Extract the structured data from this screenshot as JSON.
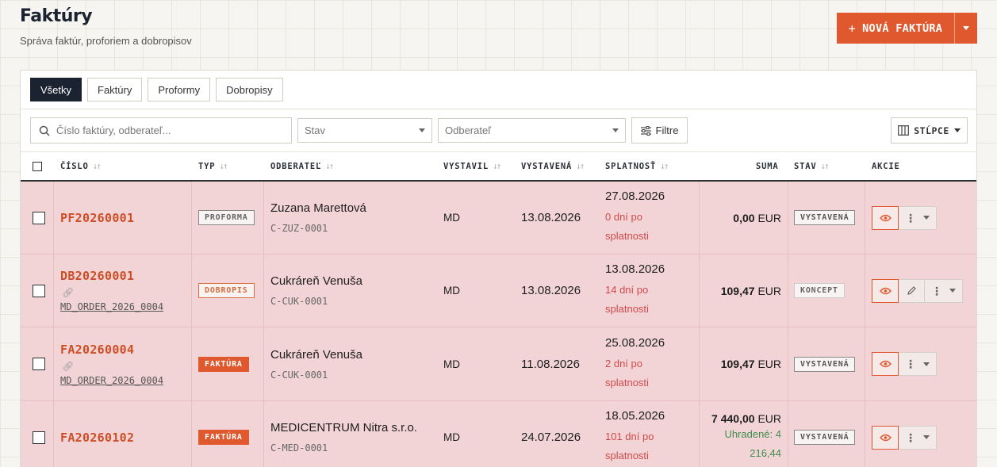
{
  "header": {
    "title": "Faktúry",
    "subtitle": "Správa faktúr, proforiem a dobropisov",
    "new_button": "NOVÁ FAKTÚRA"
  },
  "tabs": [
    {
      "label": "Všetky",
      "active": true
    },
    {
      "label": "Faktúry",
      "active": false
    },
    {
      "label": "Proformy",
      "active": false
    },
    {
      "label": "Dobropisy",
      "active": false
    }
  ],
  "filters": {
    "search_placeholder": "Číslo faktúry, odberateľ...",
    "status_placeholder": "Stav",
    "customer_placeholder": "Odberateľ",
    "filter_button": "Filtre",
    "columns_button": "STĹPCE"
  },
  "columns": {
    "number": "ČÍSLO",
    "type": "TYP",
    "customer": "ODBERATEĽ",
    "issued_by": "VYSTAVIL",
    "issued": "VYSTAVENÁ",
    "due": "SPLATNOSŤ",
    "amount": "SUMA",
    "status": "STAV",
    "actions": "AKCIE"
  },
  "rows": [
    {
      "number": "PF20260001",
      "order": "",
      "type": "PROFORMA",
      "customer_name": "Zuzana Marettová",
      "customer_code": "C-ZUZ-0001",
      "issued_by": "MD",
      "issued": "13.08.2026",
      "due": "27.08.2026",
      "overdue_1": "0 dní po",
      "overdue_2": "splatnosti",
      "amount": "0,00",
      "currency": "EUR",
      "paid_1": "",
      "paid_2": "",
      "status": "VYSTAVENÁ"
    },
    {
      "number": "DB20260001",
      "order": "MD_ORDER_2026_0004",
      "type": "DOBROPIS",
      "customer_name": "Cukráreň Venuša",
      "customer_code": "C-CUK-0001",
      "issued_by": "MD",
      "issued": "13.08.2026",
      "due": "13.08.2026",
      "overdue_1": "14 dní po",
      "overdue_2": "splatnosti",
      "amount": "109,47",
      "currency": "EUR",
      "paid_1": "",
      "paid_2": "",
      "status": "KONCEPT"
    },
    {
      "number": "FA20260004",
      "order": "MD_ORDER_2026_0004",
      "type": "FAKTÚRA",
      "customer_name": "Cukráreň Venuša",
      "customer_code": "C-CUK-0001",
      "issued_by": "MD",
      "issued": "11.08.2026",
      "due": "25.08.2026",
      "overdue_1": "2 dní po",
      "overdue_2": "splatnosti",
      "amount": "109,47",
      "currency": "EUR",
      "paid_1": "",
      "paid_2": "",
      "status": "VYSTAVENÁ"
    },
    {
      "number": "FA20260102",
      "order": "",
      "type": "FAKTÚRA",
      "customer_name": "MEDICENTRUM Nitra s.r.o.",
      "customer_code": "C-MED-0001",
      "issued_by": "MD",
      "issued": "24.07.2026",
      "due": "18.05.2026",
      "overdue_1": "101 dní po",
      "overdue_2": "splatnosti",
      "amount": "7 440,00",
      "currency": "EUR",
      "paid_1": "Uhradené: 4",
      "paid_2": "216,44",
      "status": "VYSTAVENÁ"
    }
  ],
  "colors": {
    "accent": "#e0582e",
    "row_overdue_bg": "#f3d4d6",
    "overdue_text": "#d04a4a",
    "paid_text": "#3e8e4c",
    "dark": "#1b2230"
  }
}
